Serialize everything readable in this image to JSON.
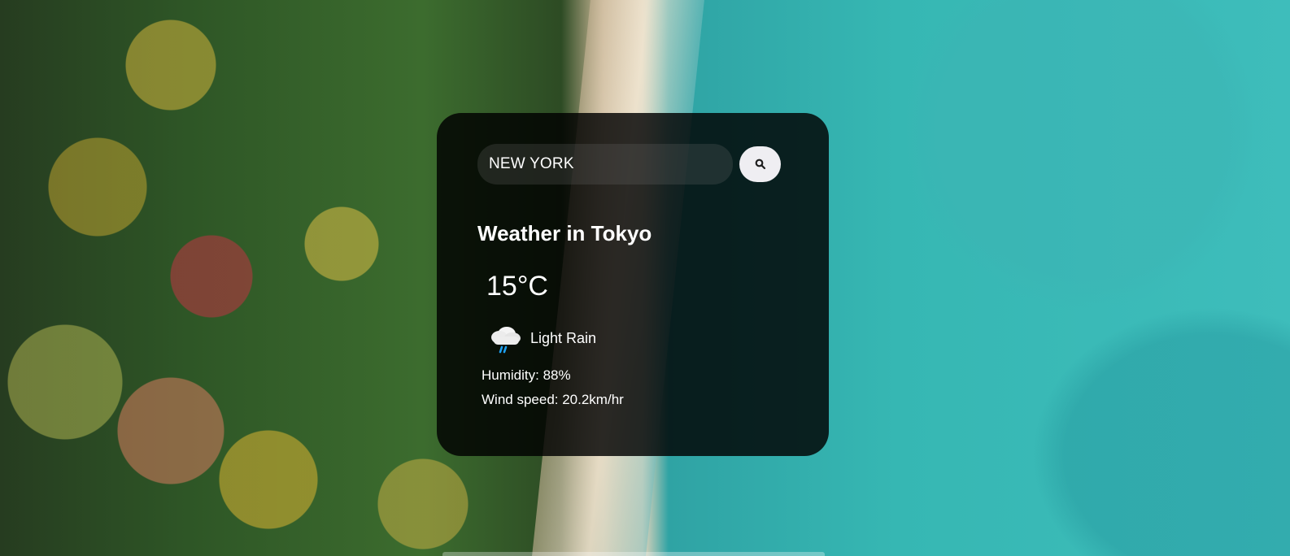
{
  "search": {
    "value": "NEW YORK",
    "placeholder": ""
  },
  "weather": {
    "title": "Weather in Tokyo",
    "temperature": "15°C",
    "condition": "Light Rain",
    "humidity": "Humidity: 88%",
    "wind": "Wind speed: 20.2km/hr"
  },
  "icons": {
    "search": "search-icon",
    "weather": "light-rain-icon"
  },
  "colors": {
    "card_background": "#000000",
    "button_background": "#efeef2",
    "text": "#ffffff"
  }
}
